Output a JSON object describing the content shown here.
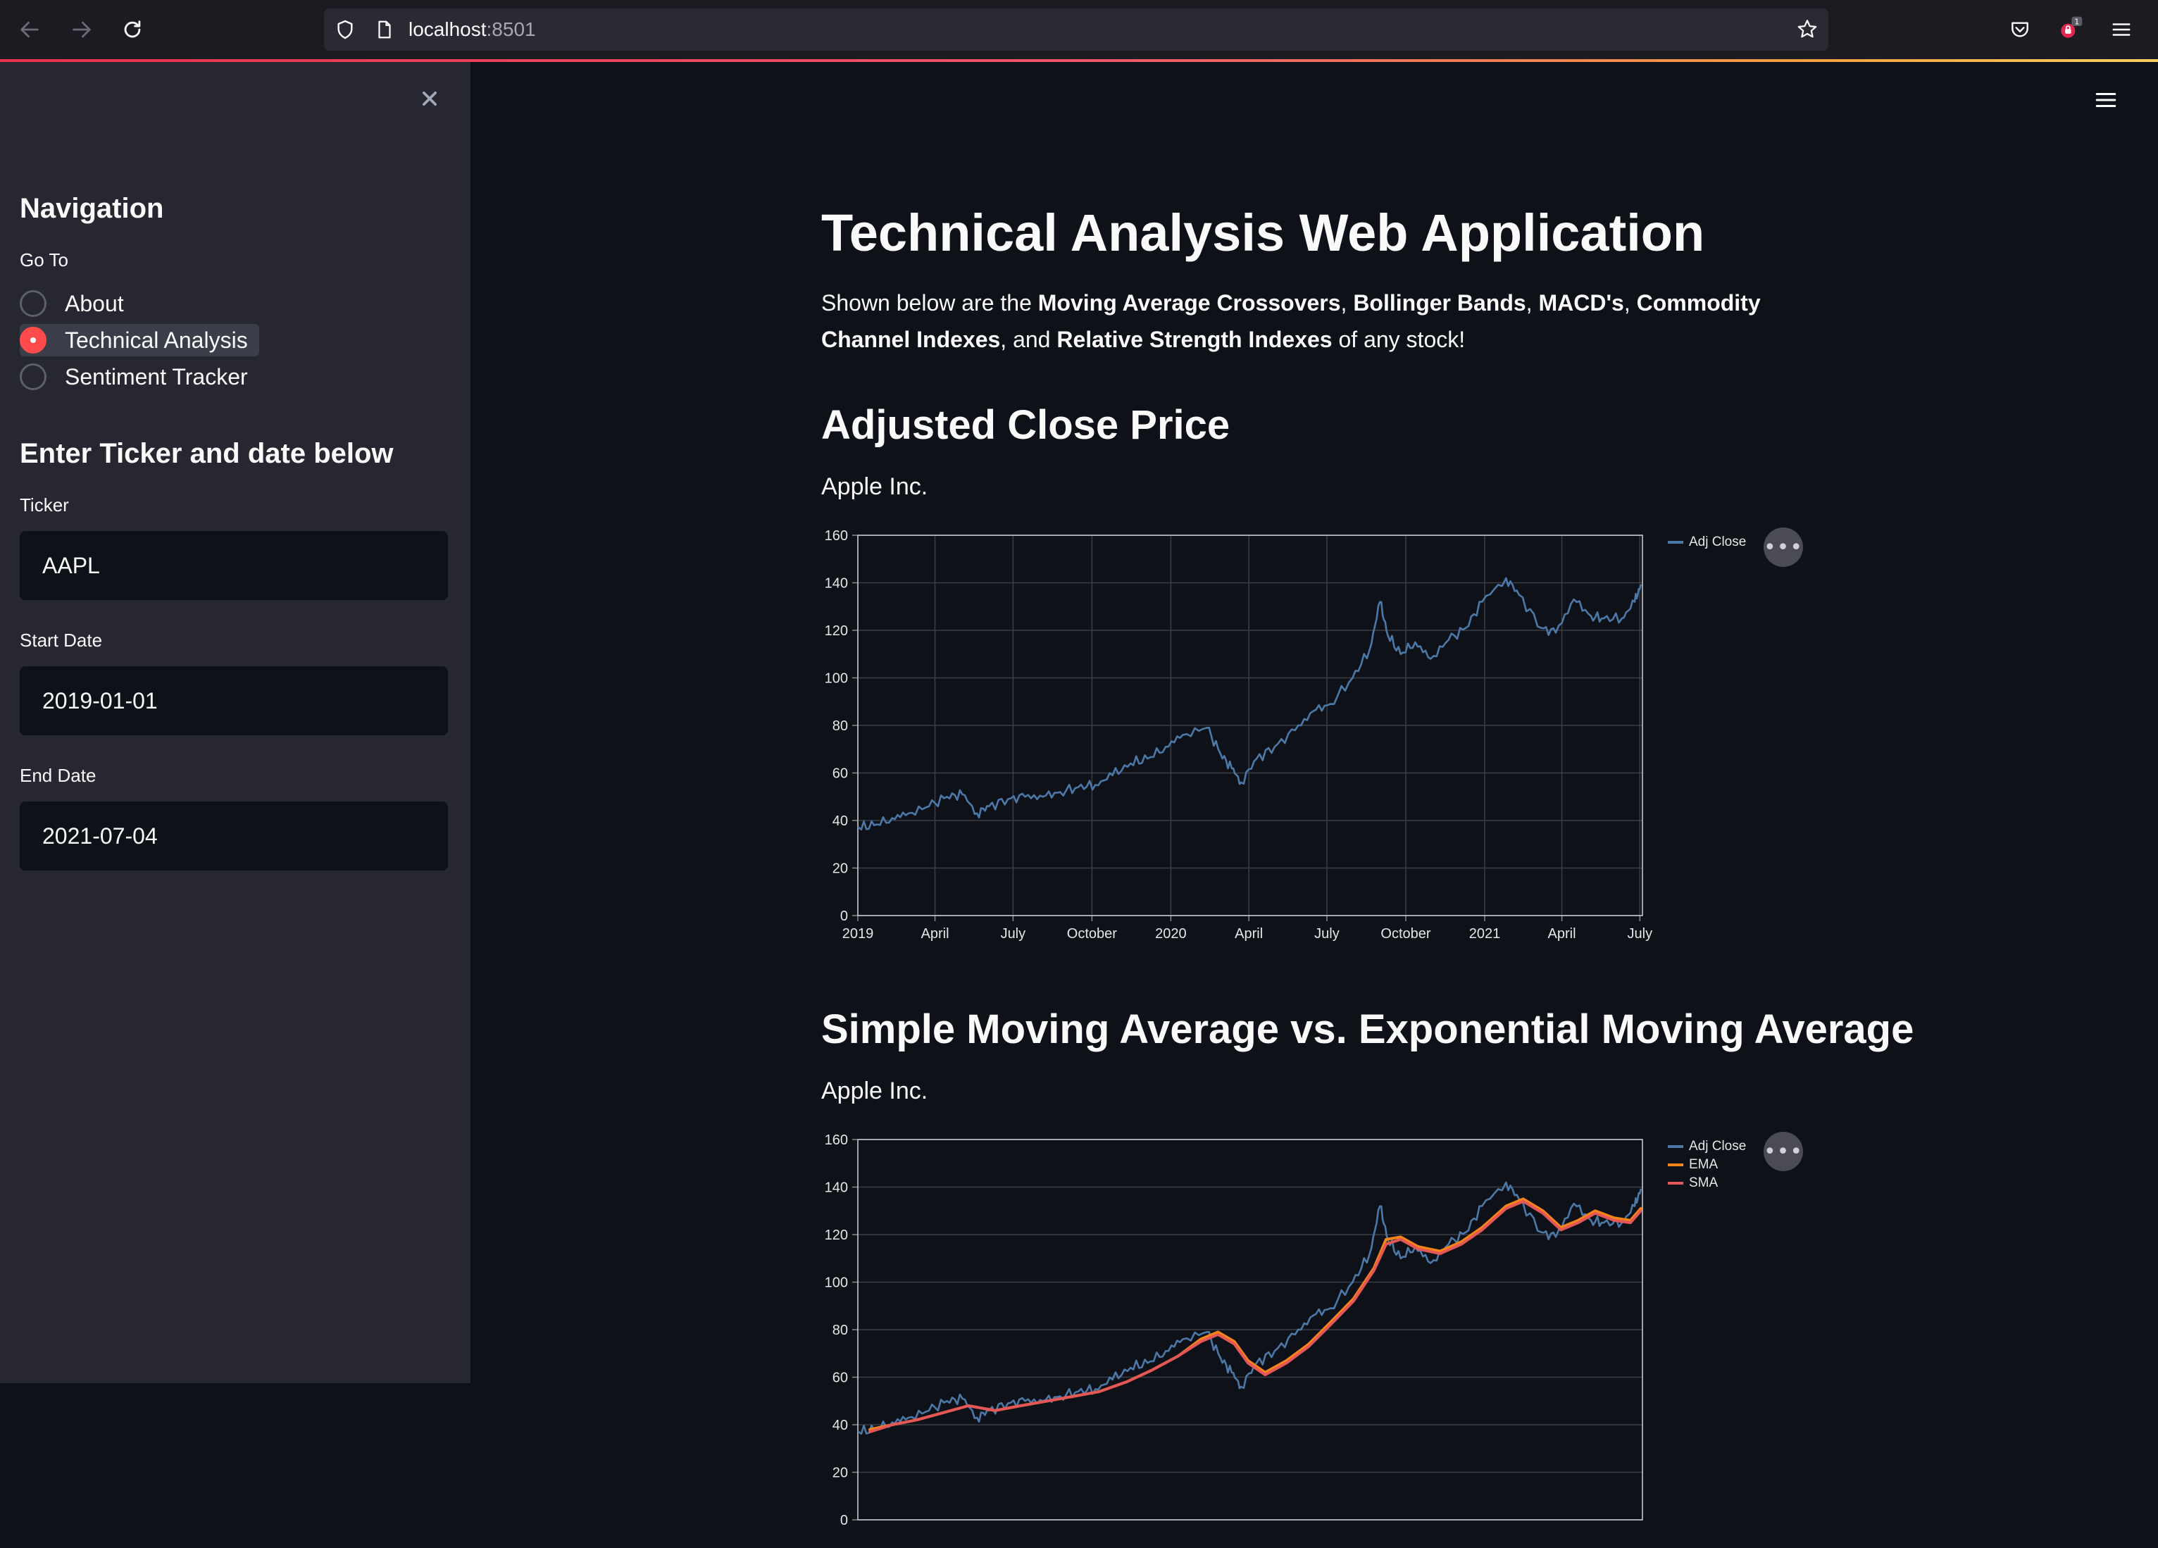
{
  "browser": {
    "url_host": "localhost",
    "url_port": ":8501",
    "notification_count": "1"
  },
  "sidebar": {
    "navigation_heading": "Navigation",
    "goto_label": "Go To",
    "radio_options": [
      {
        "label": "About",
        "selected": false
      },
      {
        "label": "Technical Analysis",
        "selected": true
      },
      {
        "label": "Sentiment Tracker",
        "selected": false
      }
    ],
    "inputs_heading": "Enter Ticker and date below",
    "ticker": {
      "label": "Ticker",
      "value": "AAPL"
    },
    "start_date": {
      "label": "Start Date",
      "value": "2019-01-01"
    },
    "end_date": {
      "label": "End Date",
      "value": "2021-07-04"
    }
  },
  "main": {
    "title": "Technical Analysis Web Application",
    "intro": {
      "p1": "Shown below are the ",
      "b1": "Moving Average Crossovers",
      "p2": ", ",
      "b2": "Bollinger Bands",
      "p3": ", ",
      "b3": "MACD's",
      "p4": ", ",
      "b4": "Commodity Channel Indexes",
      "p5": ", and ",
      "b5": "Relative Strength Indexes",
      "p6": " of any stock!"
    },
    "section1": {
      "heading": "Adjusted Close Price",
      "subtitle": "Apple Inc."
    },
    "section2": {
      "heading": "Simple Moving Average vs. Exponential Moving Average",
      "subtitle": "Apple Inc."
    },
    "more_button": "•••"
  },
  "colors": {
    "accent": "#ff4b4b",
    "adj_close": "#4c78a8",
    "ema": "#f58518",
    "sma": "#e45756"
  },
  "chart_data": [
    {
      "type": "line",
      "title": "",
      "xlabel": "",
      "ylabel": "",
      "ylim": [
        0,
        160
      ],
      "xlim": [
        "2019-01-01",
        "2021-07-04"
      ],
      "yticks": [
        0,
        20,
        40,
        60,
        80,
        100,
        120,
        140,
        160
      ],
      "xticks": [
        {
          "date": "2019-01-01",
          "label": "2019"
        },
        {
          "date": "2019-04-01",
          "label": "April"
        },
        {
          "date": "2019-07-01",
          "label": "July"
        },
        {
          "date": "2019-10-01",
          "label": "October"
        },
        {
          "date": "2020-01-01",
          "label": "2020"
        },
        {
          "date": "2020-04-01",
          "label": "April"
        },
        {
          "date": "2020-07-01",
          "label": "July"
        },
        {
          "date": "2020-10-01",
          "label": "October"
        },
        {
          "date": "2021-01-01",
          "label": "2021"
        },
        {
          "date": "2021-04-01",
          "label": "April"
        },
        {
          "date": "2021-07-01",
          "label": "July"
        }
      ],
      "grid": true,
      "legend_position": "top-right",
      "series": [
        {
          "name": "Adj Close",
          "color": "#4c78a8",
          "x": [
            "2019-01-02",
            "2019-01-20",
            "2019-02-10",
            "2019-03-01",
            "2019-03-25",
            "2019-04-15",
            "2019-05-03",
            "2019-05-20",
            "2019-06-03",
            "2019-06-25",
            "2019-07-15",
            "2019-08-05",
            "2019-08-25",
            "2019-09-15",
            "2019-10-05",
            "2019-10-25",
            "2019-11-15",
            "2019-12-05",
            "2019-12-26",
            "2020-01-15",
            "2020-02-12",
            "2020-02-28",
            "2020-03-12",
            "2020-03-23",
            "2020-04-10",
            "2020-05-01",
            "2020-05-25",
            "2020-06-15",
            "2020-07-05",
            "2020-07-31",
            "2020-08-20",
            "2020-09-01",
            "2020-09-10",
            "2020-09-25",
            "2020-10-12",
            "2020-10-30",
            "2020-11-20",
            "2020-12-10",
            "2020-12-29",
            "2021-01-26",
            "2021-02-10",
            "2021-03-08",
            "2021-03-25",
            "2021-04-15",
            "2021-05-05",
            "2021-05-20",
            "2021-06-10",
            "2021-06-25",
            "2021-07-02"
          ],
          "y": [
            37,
            38,
            41,
            43,
            46,
            50,
            51,
            43,
            46,
            49,
            50,
            50,
            52,
            54,
            55,
            59,
            64,
            66,
            71,
            76,
            79,
            68,
            62,
            56,
            66,
            71,
            78,
            86,
            89,
            100,
            112,
            132,
            118,
            110,
            115,
            108,
            116,
            121,
            132,
            142,
            135,
            121,
            119,
            133,
            126,
            125,
            125,
            132,
            139
          ]
        }
      ]
    },
    {
      "type": "line",
      "title": "",
      "xlabel": "",
      "ylabel": "",
      "ylim": [
        0,
        160
      ],
      "xlim": [
        "2019-01-01",
        "2021-07-04"
      ],
      "yticks": [
        0,
        20,
        40,
        60,
        80,
        100,
        120,
        140,
        160
      ],
      "grid": true,
      "legend_position": "top-right",
      "series": [
        {
          "name": "Adj Close",
          "color": "#4c78a8",
          "x": [
            "2019-01-02",
            "2019-01-20",
            "2019-02-10",
            "2019-03-01",
            "2019-03-25",
            "2019-04-15",
            "2019-05-03",
            "2019-05-20",
            "2019-06-03",
            "2019-06-25",
            "2019-07-15",
            "2019-08-05",
            "2019-08-25",
            "2019-09-15",
            "2019-10-05",
            "2019-10-25",
            "2019-11-15",
            "2019-12-05",
            "2019-12-26",
            "2020-01-15",
            "2020-02-12",
            "2020-02-28",
            "2020-03-12",
            "2020-03-23",
            "2020-04-10",
            "2020-05-01",
            "2020-05-25",
            "2020-06-15",
            "2020-07-05",
            "2020-07-31",
            "2020-08-20",
            "2020-09-01",
            "2020-09-10",
            "2020-09-25",
            "2020-10-12",
            "2020-10-30",
            "2020-11-20",
            "2020-12-10",
            "2020-12-29",
            "2021-01-26",
            "2021-02-10",
            "2021-03-08",
            "2021-03-25",
            "2021-04-15",
            "2021-05-05",
            "2021-05-20",
            "2021-06-10",
            "2021-06-25",
            "2021-07-02"
          ],
          "y": [
            37,
            38,
            41,
            43,
            46,
            50,
            51,
            43,
            46,
            49,
            50,
            50,
            52,
            54,
            55,
            59,
            64,
            66,
            71,
            76,
            79,
            68,
            62,
            56,
            66,
            71,
            78,
            86,
            89,
            100,
            112,
            132,
            118,
            110,
            115,
            108,
            116,
            121,
            132,
            142,
            135,
            121,
            119,
            133,
            126,
            125,
            125,
            132,
            139
          ]
        },
        {
          "name": "EMA",
          "color": "#f58518",
          "x": [
            "2019-01-15",
            "2019-02-10",
            "2019-03-10",
            "2019-04-10",
            "2019-05-10",
            "2019-06-10",
            "2019-07-10",
            "2019-08-10",
            "2019-09-10",
            "2019-10-10",
            "2019-11-10",
            "2019-12-10",
            "2020-01-10",
            "2020-02-05",
            "2020-02-25",
            "2020-03-15",
            "2020-03-31",
            "2020-04-20",
            "2020-05-15",
            "2020-06-10",
            "2020-07-05",
            "2020-08-01",
            "2020-08-25",
            "2020-09-08",
            "2020-09-25",
            "2020-10-15",
            "2020-11-10",
            "2020-12-05",
            "2020-12-29",
            "2021-01-26",
            "2021-02-15",
            "2021-03-10",
            "2021-03-31",
            "2021-04-20",
            "2021-05-10",
            "2021-06-01",
            "2021-06-20",
            "2021-07-02"
          ],
          "y": [
            38,
            40,
            42,
            45,
            48,
            46,
            48,
            50,
            52,
            54,
            58,
            63,
            69,
            76,
            79,
            75,
            67,
            62,
            67,
            74,
            83,
            93,
            106,
            118,
            119,
            115,
            113,
            117,
            123,
            132,
            135,
            130,
            123,
            126,
            130,
            127,
            126,
            131
          ]
        },
        {
          "name": "SMA",
          "color": "#e45756",
          "x": [
            "2019-01-15",
            "2019-02-10",
            "2019-03-10",
            "2019-04-10",
            "2019-05-10",
            "2019-06-10",
            "2019-07-10",
            "2019-08-10",
            "2019-09-10",
            "2019-10-10",
            "2019-11-10",
            "2019-12-10",
            "2020-01-10",
            "2020-02-05",
            "2020-02-25",
            "2020-03-15",
            "2020-03-31",
            "2020-04-20",
            "2020-05-15",
            "2020-06-10",
            "2020-07-05",
            "2020-08-01",
            "2020-08-25",
            "2020-09-08",
            "2020-09-25",
            "2020-10-15",
            "2020-11-10",
            "2020-12-05",
            "2020-12-29",
            "2021-01-26",
            "2021-02-15",
            "2021-03-10",
            "2021-03-31",
            "2021-04-20",
            "2021-05-10",
            "2021-06-01",
            "2021-06-20",
            "2021-07-02"
          ],
          "y": [
            37,
            40,
            42,
            45,
            48,
            46,
            48,
            50,
            52,
            54,
            58,
            63,
            69,
            75,
            78,
            74,
            66,
            61,
            66,
            73,
            82,
            92,
            105,
            116,
            118,
            114,
            112,
            116,
            122,
            131,
            134,
            129,
            122,
            125,
            129,
            126,
            125,
            130
          ]
        }
      ]
    }
  ]
}
